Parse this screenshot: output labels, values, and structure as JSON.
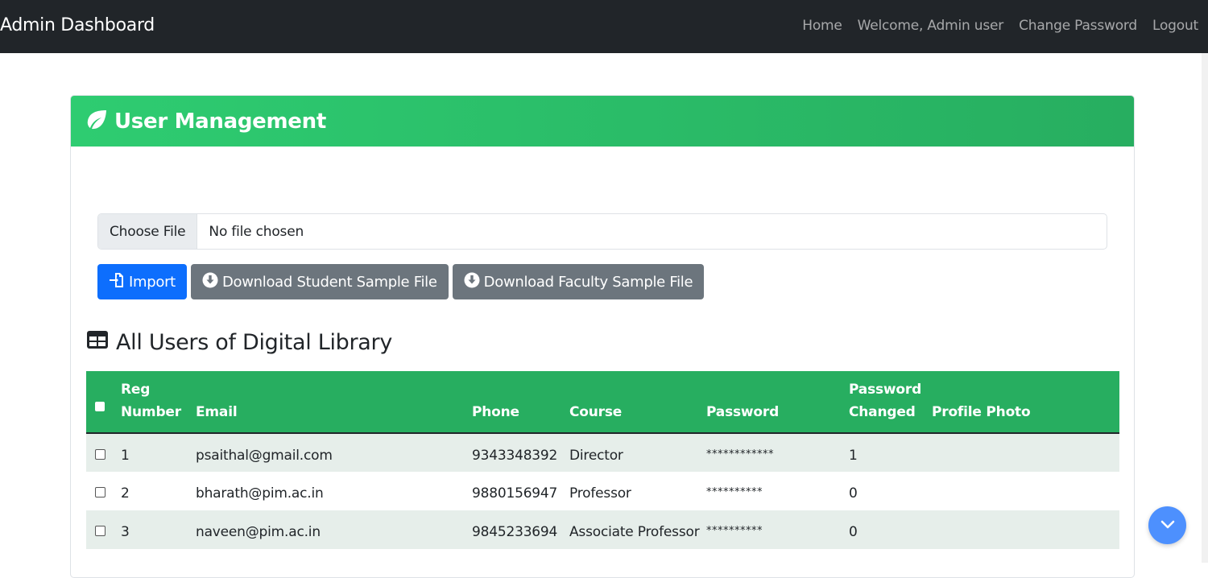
{
  "navbar": {
    "brand": "Admin Dashboard",
    "links": [
      "Home",
      "Welcome, Admin user",
      "Change Password",
      "Logout"
    ]
  },
  "card": {
    "title": "User Management",
    "title_icon": "leaf-icon"
  },
  "file_input": {
    "button_label": "Choose File",
    "status": "No file chosen"
  },
  "buttons": {
    "import": "Import",
    "download_student": "Download Student Sample File",
    "download_faculty": "Download Faculty Sample File"
  },
  "section": {
    "title": "All Users of Digital Library",
    "icon": "table-icon"
  },
  "table": {
    "headers": {
      "reg_line1": "Reg",
      "reg_line2": "Number",
      "email": "Email",
      "phone": "Phone",
      "course": "Course",
      "password": "Password",
      "pw_changed_line1": "Password",
      "pw_changed_line2": "Changed",
      "profile_photo": "Profile Photo"
    },
    "rows": [
      {
        "reg": "1",
        "email": "psaithal@gmail.com",
        "phone": "9343348392",
        "course": "Director",
        "password": "************",
        "changed": "1",
        "photo": ""
      },
      {
        "reg": "2",
        "email": "bharath@pim.ac.in",
        "phone": "9880156947",
        "course": "Professor",
        "password": "**********",
        "changed": "0",
        "photo": ""
      },
      {
        "reg": "3",
        "email": "naveen@pim.ac.in",
        "phone": "9845233694",
        "course": "Associate Professor",
        "password": "**********",
        "changed": "0",
        "photo": ""
      }
    ]
  },
  "colors": {
    "navbar_bg": "#212529",
    "header_green": "#27ae60",
    "primary": "#0d6efd",
    "secondary": "#6c757d",
    "fab": "#4d90fe"
  },
  "fab_icon": "chevron-down-icon"
}
